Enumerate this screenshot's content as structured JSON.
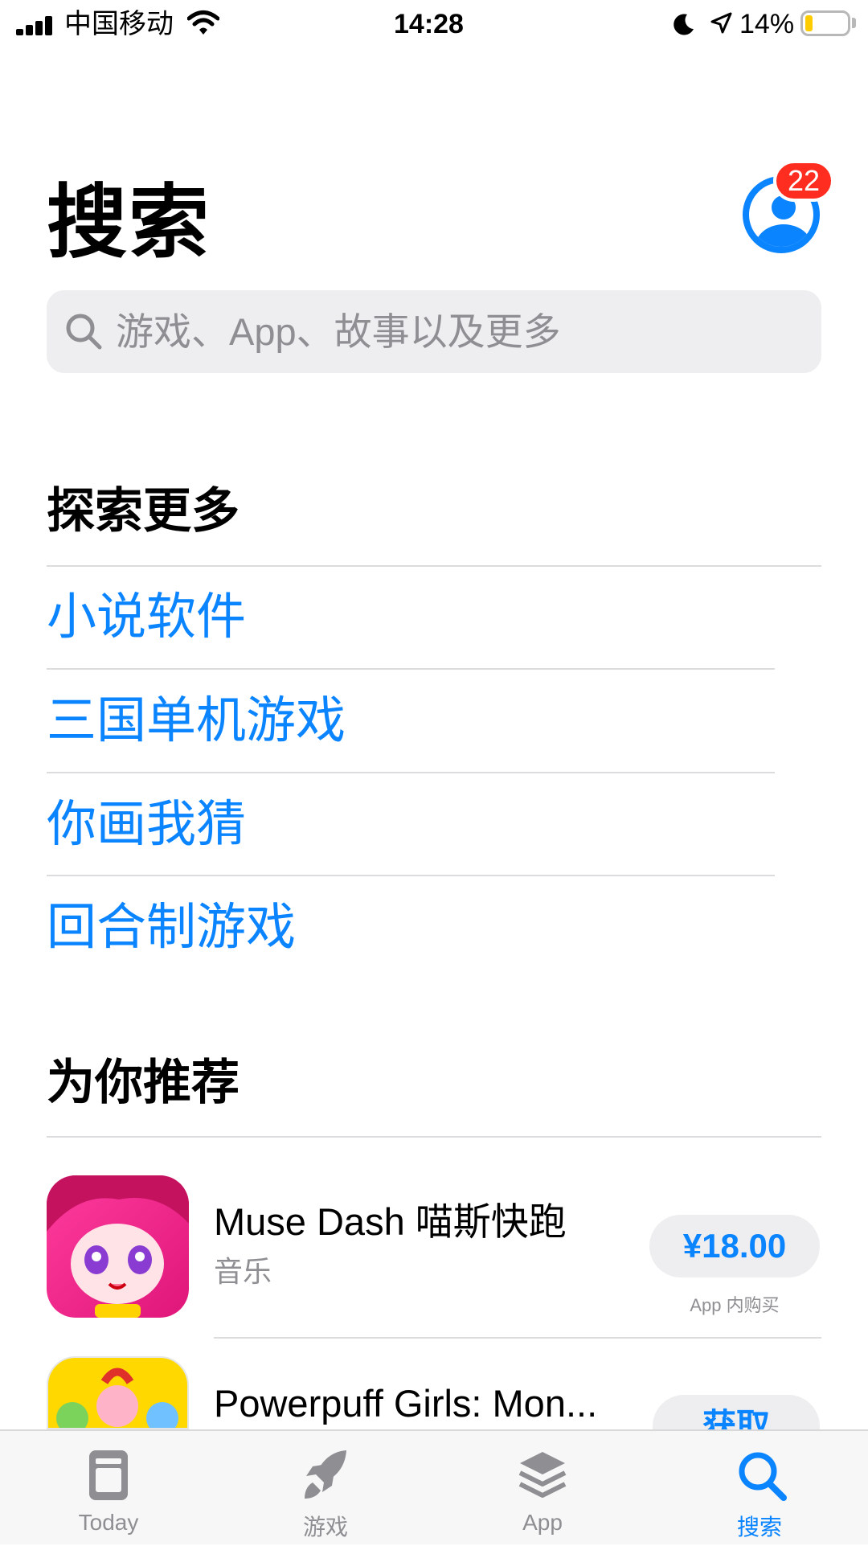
{
  "status_bar": {
    "carrier": "中国移动",
    "time": "14:28",
    "battery_percent": "14%",
    "battery_level": 0.14,
    "icons": [
      "signal-icon",
      "wifi-icon",
      "moon-icon",
      "location-icon",
      "battery-icon"
    ]
  },
  "header": {
    "title": "搜索",
    "badge_count": "22"
  },
  "search": {
    "placeholder": "游戏、App、故事以及更多",
    "icon": "search-icon"
  },
  "explore": {
    "title": "探索更多",
    "items": [
      "小说软件",
      "三国单机游戏",
      "你画我猜",
      "回合制游戏"
    ]
  },
  "recommend": {
    "title": "为你推荐",
    "apps": [
      {
        "name": "Muse Dash 喵斯快跑",
        "category": "音乐",
        "price": "¥18.00",
        "note": "App 内购买"
      },
      {
        "name": "Powerpuff Girls: Mon...",
        "category": "",
        "price": "获取",
        "note": ""
      }
    ]
  },
  "tabbar": {
    "tabs": [
      {
        "label": "Today",
        "icon": "today-icon"
      },
      {
        "label": "游戏",
        "icon": "rocket-icon"
      },
      {
        "label": "App",
        "icon": "apps-stack-icon"
      },
      {
        "label": "搜索",
        "icon": "search-icon",
        "active": true
      }
    ]
  },
  "colors": {
    "accent": "#0a84ff",
    "badge": "#ff2d1f",
    "secondary_text": "#8e8e93"
  }
}
